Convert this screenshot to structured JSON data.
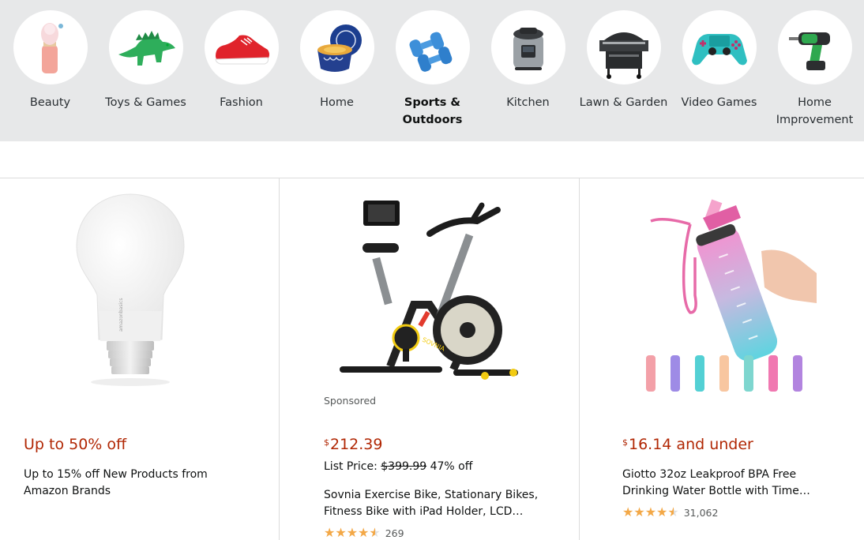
{
  "categories": [
    {
      "label": "Beauty",
      "icon": "beauty-brush-icon"
    },
    {
      "label": "Toys & Games",
      "icon": "dinosaur-toy-icon"
    },
    {
      "label": "Fashion",
      "icon": "sneaker-icon"
    },
    {
      "label": "Home",
      "icon": "candle-icon"
    },
    {
      "label": "Sports & Outdoors",
      "icon": "dumbbells-icon",
      "selected": true
    },
    {
      "label": "Kitchen",
      "icon": "pressure-cooker-icon"
    },
    {
      "label": "Lawn & Garden",
      "icon": "grill-icon"
    },
    {
      "label": "Video Games",
      "icon": "game-controller-icon"
    },
    {
      "label": "Home Improvement",
      "icon": "power-drill-icon"
    }
  ],
  "products": [
    {
      "image": "light-bulb-image",
      "price": "Up to 50% off",
      "description_line1": "Up to 15% off New Products from",
      "description_line2": "Amazon Brands"
    },
    {
      "image": "exercise-bike-image",
      "sponsored": "Sponsored",
      "price_currency": "$",
      "price_value": "212.39",
      "list_price_label": "List Price:",
      "list_price_value": "$399.99",
      "discount": "47% off",
      "description_line1": "Sovnia Exercise Bike, Stationary Bikes,",
      "description_line2": "Fitness Bike with iPad Holder, LCD…",
      "rating": 4.5,
      "rating_count": "269"
    },
    {
      "image": "water-bottle-image",
      "price_currency": "$",
      "price_value": "16.14 and under",
      "description_line1": "Giotto 32oz Leakproof BPA Free",
      "description_line2": "Drinking Water Bottle with Time…",
      "rating": 4.5,
      "rating_count": "31,062"
    }
  ],
  "colors": {
    "category_bar_bg": "#e7e8e9",
    "price_red": "#b12704",
    "star_orange": "#f3a847"
  }
}
